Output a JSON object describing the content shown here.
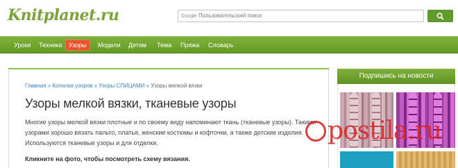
{
  "header": {
    "logo_text": "Knitplanet.ru",
    "search": {
      "prefix": "Google",
      "placeholder": "Пользовательский поиск"
    }
  },
  "nav": {
    "items": [
      {
        "label": "Уроки",
        "active": false
      },
      {
        "label": "Техника",
        "active": false
      },
      {
        "label": "Узоры",
        "active": true
      },
      {
        "label": "Модели",
        "active": false
      },
      {
        "label": "Детям",
        "active": false
      },
      {
        "label": "Тема",
        "active": false
      },
      {
        "label": "Пряжа",
        "active": false
      },
      {
        "label": "Словарь",
        "active": false
      }
    ]
  },
  "breadcrumb": {
    "items": [
      "Главная",
      "Копилка узоров",
      "Узоры СПИЦАМИ"
    ],
    "separator": "»",
    "current": "Узоры мелкой вязки"
  },
  "main": {
    "title": "Узоры мелкой вязки, тканевые узоры",
    "intro": "Многие узоры мелкой вязки плотные и по своему виду напоминают ткань (тканевые узоры). Такими узорами хорошо вязать пальто, платья, женские костюмы и кофточки, а также детские изделия. Используются тканевые узоры и для отделки.",
    "cta": "Кликните на фото, чтобы посмотреть схему вязания."
  },
  "sidebar": {
    "title": "Подпишись на новости"
  },
  "watermark": "postila.ru",
  "colors": {
    "brand_green": "#7aa33a",
    "nav_green": "#6fa52c",
    "active_tab": "#e5542d",
    "link_blue": "#3d7fb8",
    "watermark_red": "#d72828"
  }
}
